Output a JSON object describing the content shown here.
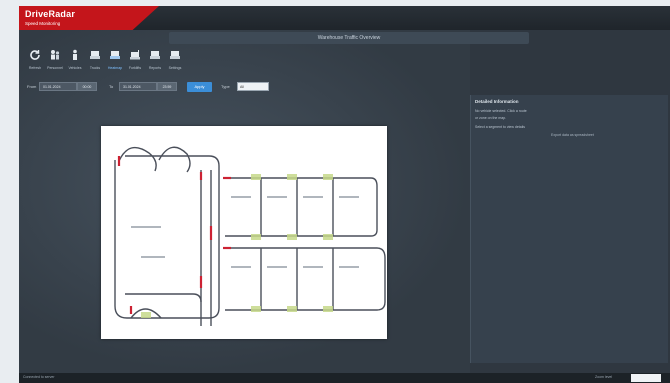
{
  "app": {
    "brand": "DriveRadar",
    "brand_sub": "Speed Monitoring",
    "window_title": "Warehouse Traffic Overview"
  },
  "toolbar": {
    "items": [
      {
        "label": "Refresh",
        "icon": "refresh-icon",
        "active": false
      },
      {
        "label": "Personnel",
        "icon": "people-icon",
        "active": false
      },
      {
        "label": "Vehicles",
        "icon": "vehicle-icon",
        "active": false
      },
      {
        "label": "Trucks",
        "icon": "truck-icon",
        "active": false
      },
      {
        "label": "Heatmap",
        "icon": "truck-icon",
        "active": true
      },
      {
        "label": "Forklifts",
        "icon": "forklift-icon",
        "active": false
      },
      {
        "label": "Reports",
        "icon": "truck-icon",
        "active": false
      },
      {
        "label": "Settings",
        "icon": "truck-icon",
        "active": false
      }
    ]
  },
  "filters": {
    "from_label": "From",
    "from_date": "01.01.2024",
    "from_time": "00:00",
    "to_label": "To",
    "to_date": "31.01.2024",
    "to_time": "23:59",
    "apply_label": "Apply",
    "type_label": "Type",
    "type_value": "All"
  },
  "side_panel": {
    "title": "Detailed Information",
    "lines": [
      "No vehicle selected. Click a route",
      "or zone on the map.",
      "Select a segment to view details"
    ],
    "link": "Export data as spreadsheet"
  },
  "status": {
    "left": "Connected to server",
    "right": "Zoom level"
  },
  "colors": {
    "accent": "#c4151b",
    "route": "#4a4f5a",
    "speed_high": "#cc2233",
    "speed_ok": "#9acd32"
  }
}
